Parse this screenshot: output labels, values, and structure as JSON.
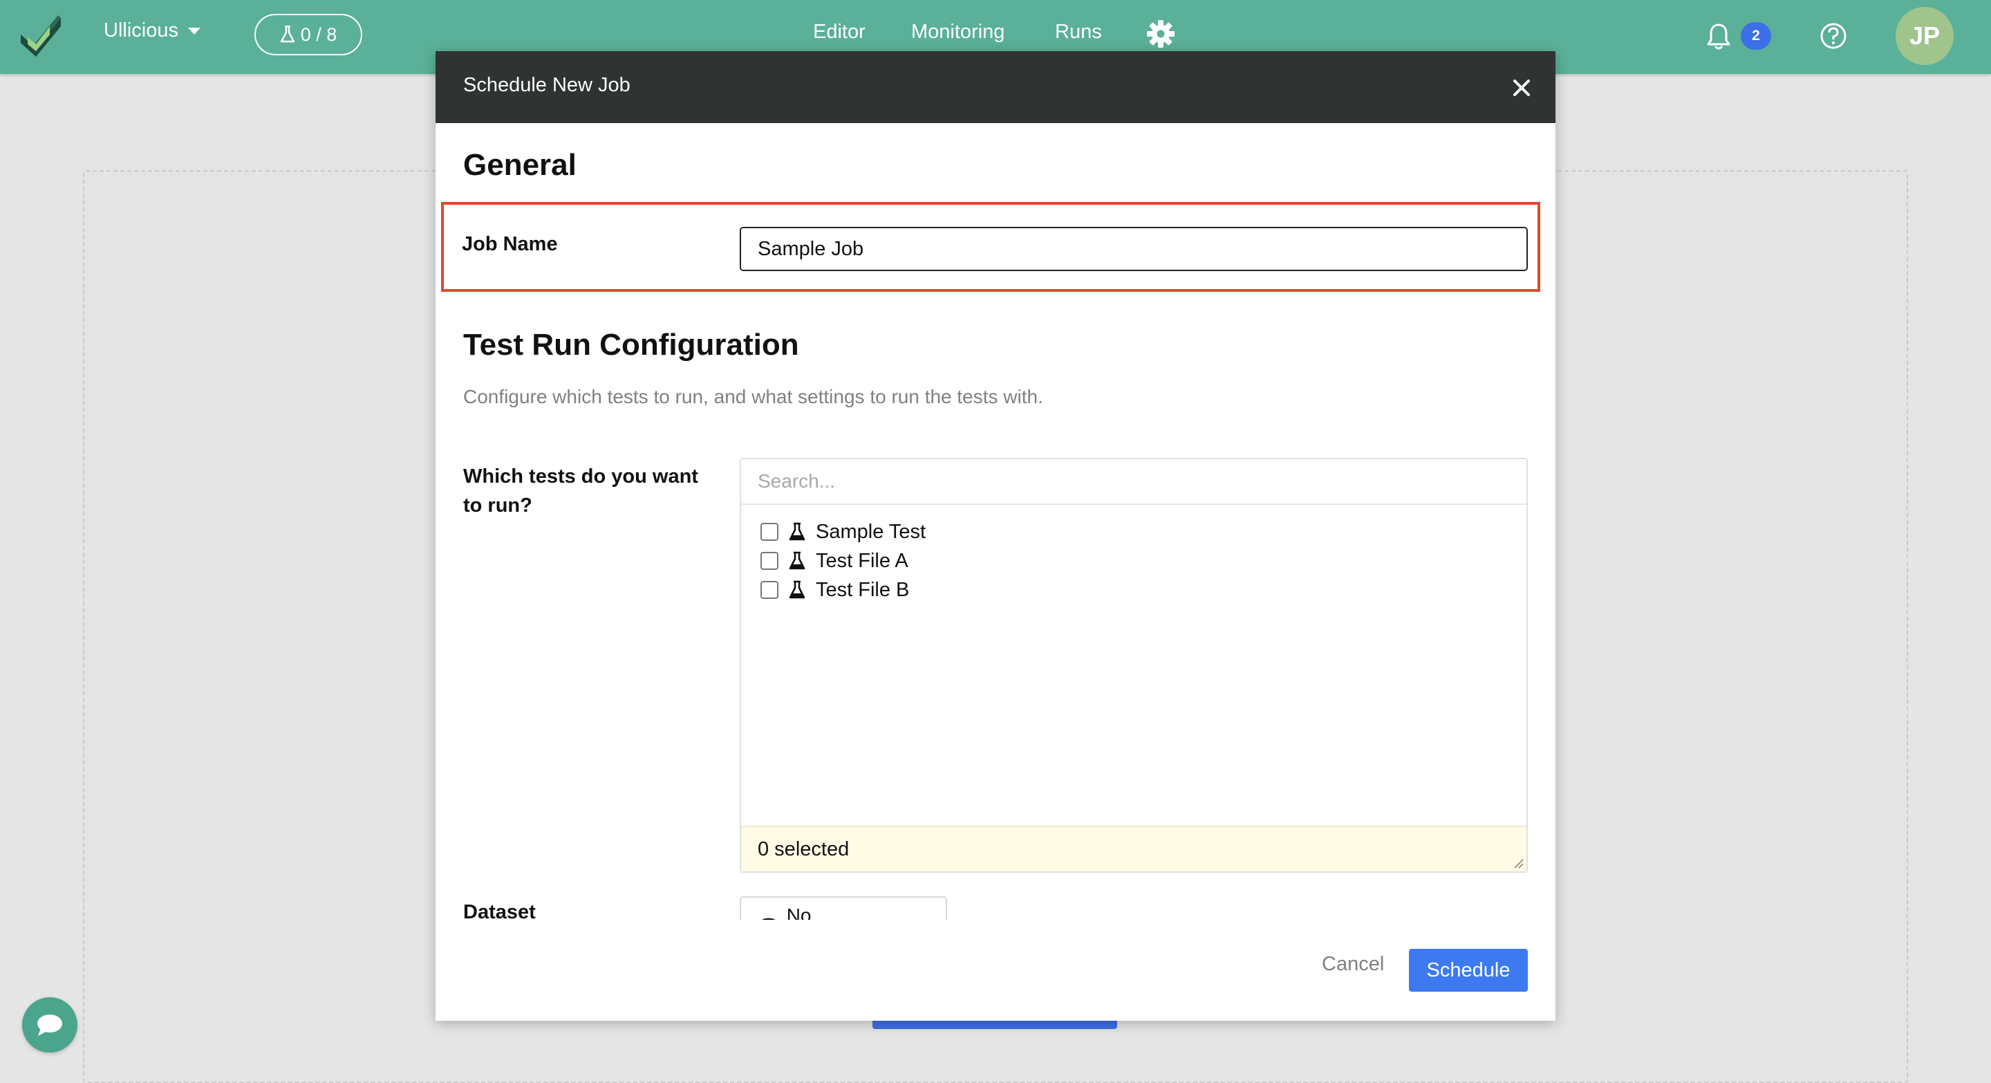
{
  "navbar": {
    "org_name": "Ullicious",
    "test_counter": "0 / 8",
    "links": [
      "Editor",
      "Monitoring",
      "Runs"
    ],
    "notification_count": "2",
    "avatar_initials": "JP"
  },
  "modal": {
    "title": "Schedule New Job",
    "general_heading": "General",
    "job_name_label": "Job Name",
    "job_name_value": "Sample Job",
    "config_heading": "Test Run Configuration",
    "config_description": "Configure which tests to run, and what settings to run the tests with.",
    "tests_label_line1": "Which tests do you want",
    "tests_label_line2": "to run?",
    "search_placeholder": "Search...",
    "tests": [
      "Sample Test",
      "Test File A",
      "Test File B"
    ],
    "selected_text": "0 selected",
    "dataset_label": "Dataset",
    "dataset_value": "No Dataset",
    "cancel_label": "Cancel",
    "schedule_label": "Schedule"
  },
  "colors": {
    "navbar": "#5ab098",
    "modal_header": "#2f3332",
    "primary": "#3d7af0",
    "highlight_border": "#e04a2f",
    "selected_bar": "#fffbe5"
  }
}
